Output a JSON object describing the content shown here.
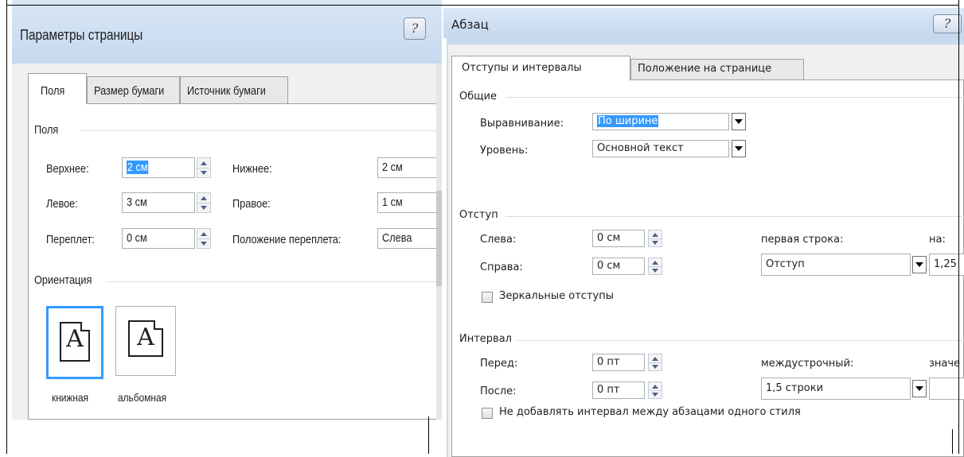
{
  "page_setup": {
    "title": "Параметры страницы",
    "help_glyph": "?",
    "tabs": [
      "Поля",
      "Размер бумаги",
      "Источник бумаги"
    ],
    "group_margins": "Поля",
    "top_label": "Верхнее:",
    "top_value": "2 см",
    "bottom_label": "Нижнее:",
    "bottom_value": "2 см",
    "left_label": "Левое:",
    "left_value": "3 см",
    "right_label": "Правое:",
    "right_value": "1 см",
    "gutter_label": "Переплет:",
    "gutter_value": "0 см",
    "gutter_pos_label": "Положение переплета:",
    "gutter_pos_value": "Слева",
    "group_orientation": "Ориентация",
    "portrait_label": "книжная",
    "landscape_label": "альбомная",
    "page_glyph": "A",
    "selection_color": "#3399ff"
  },
  "paragraph": {
    "title": "Абзац",
    "help_glyph": "?",
    "tabs": [
      "Отступы и интервалы",
      "Положение на странице"
    ],
    "group_general": "Общие",
    "alignment_label": "Выравнивание:",
    "alignment_value": "По ширине",
    "level_label": "Уровень:",
    "level_value": "Основной текст",
    "group_indent": "Отступ",
    "indent_left_label": "Слева:",
    "indent_left_value": "0 см",
    "indent_right_label": "Справа:",
    "indent_right_value": "0 см",
    "first_line_label": "первая строка:",
    "first_line_value": "Отступ",
    "by_label": "на:",
    "by_value": "1,25",
    "mirror_label": "Зеркальные отступы",
    "group_spacing": "Интервал",
    "before_label": "Перед:",
    "before_value": "0 пт",
    "after_label": "После:",
    "after_value": "0 пт",
    "line_spacing_label": "междустрочный:",
    "line_spacing_value": "1,5 строки",
    "value_label": "значе",
    "no_space_label": "Не добавлять интервал между абзацами одного стиля"
  }
}
